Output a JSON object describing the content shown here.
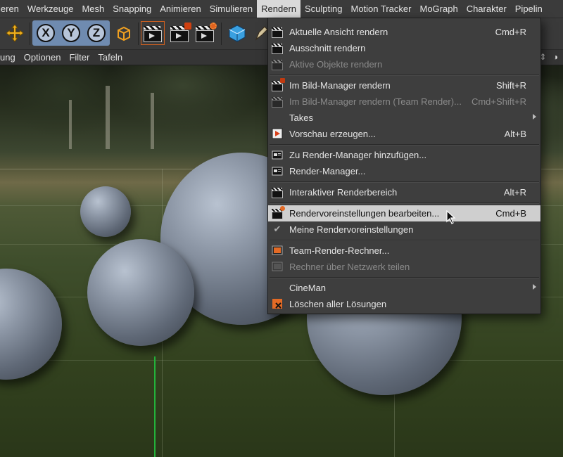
{
  "menubar": {
    "items": [
      "ieren",
      "Werkzeuge",
      "Mesh",
      "Snapping",
      "Animieren",
      "Simulieren",
      "Rendern",
      "Sculpting",
      "Motion Tracker",
      "MoGraph",
      "Charakter",
      "Pipelin"
    ]
  },
  "toolbar": {
    "axis_x": "X",
    "axis_y": "Y",
    "axis_z": "Z"
  },
  "submenu": {
    "items": [
      "ung",
      "Optionen",
      "Filter",
      "Tafeln"
    ]
  },
  "render_menu": {
    "items": [
      {
        "label": "Aktuelle Ansicht rendern",
        "shortcut": "Cmd+R",
        "icon": "clapper-icon"
      },
      {
        "label": "Ausschnitt rendern",
        "shortcut": "",
        "icon": "clapper-region-icon"
      },
      {
        "label": "Aktive Objekte rendern",
        "shortcut": "",
        "icon": "clapper-objects-icon",
        "disabled": true
      },
      {
        "label": "Im Bild-Manager rendern",
        "shortcut": "Shift+R",
        "icon": "picture-viewer-icon"
      },
      {
        "label": "Im Bild-Manager rendern (Team Render)...",
        "shortcut": "Cmd+Shift+R",
        "icon": "team-render-icon",
        "disabled": true
      },
      {
        "label": "Takes",
        "shortcut": "",
        "submenu": true
      },
      {
        "label": "Vorschau erzeugen...",
        "shortcut": "Alt+B",
        "icon": "preview-icon"
      },
      {
        "label": "Zu Render-Manager hinzufügen...",
        "shortcut": "",
        "icon": "render-queue-add-icon"
      },
      {
        "label": "Render-Manager...",
        "shortcut": "",
        "icon": "render-queue-icon"
      },
      {
        "label": "Interaktiver Renderbereich",
        "shortcut": "Alt+R",
        "icon": "ir-region-icon"
      },
      {
        "label": "Rendervoreinstellungen bearbeiten...",
        "shortcut": "Cmd+B",
        "icon": "render-settings-icon",
        "highlight": true
      },
      {
        "label": "Meine Rendervoreinstellungen",
        "shortcut": "",
        "icon": "check-icon"
      },
      {
        "label": "Team-Render-Rechner...",
        "shortcut": "",
        "icon": "team-render-machines-icon"
      },
      {
        "label": "Rechner über Netzwerk teilen",
        "shortcut": "",
        "icon": "share-machine-icon",
        "disabled": true
      },
      {
        "label": "CineMan",
        "shortcut": "",
        "submenu": true
      },
      {
        "label": "Löschen aller Lösungen",
        "shortcut": "",
        "icon": "flush-caches-icon"
      }
    ]
  },
  "colors": {
    "menu_bg": "#3e3e3e",
    "highlight_bg": "#cfcfcf",
    "accent_orange": "#e36a25",
    "axis_green": "#23b23a"
  }
}
